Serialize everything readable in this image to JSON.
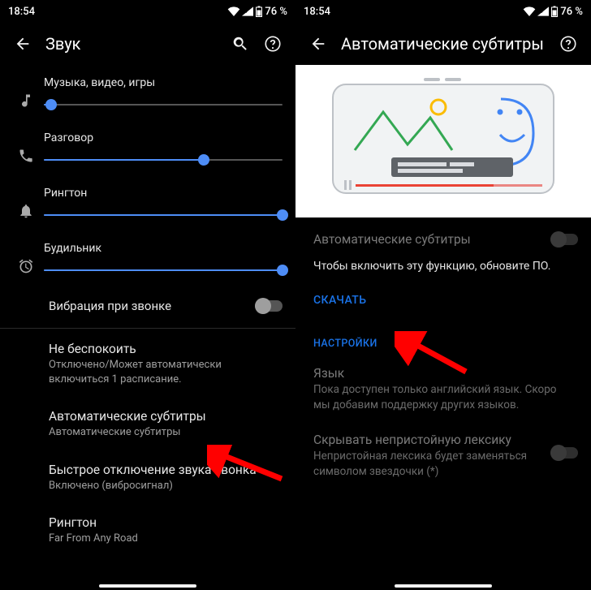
{
  "statusbar": {
    "time": "18:54",
    "battery": "76 %"
  },
  "left": {
    "title": "Звук",
    "volumes": {
      "media": {
        "label": "Музыка, видео, игры",
        "percent": 3
      },
      "call": {
        "label": "Разговор",
        "percent": 67
      },
      "ring": {
        "label": "Рингтон",
        "percent": 100
      },
      "alarm": {
        "label": "Будильник",
        "percent": 100
      }
    },
    "vibrateRing": {
      "label": "Вибрация при звонке",
      "on": false
    },
    "dnd": {
      "title": "Не беспокоить",
      "subtitle": "Отключено/Может автоматически включиться 1 расписание."
    },
    "autoCap": {
      "title": "Автоматические субтитры",
      "subtitle": "Автоматические субтитры"
    },
    "quickMute": {
      "title": "Быстрое отключение звука звонка",
      "subtitle": "Включено (вибросигнал)"
    },
    "ringtone": {
      "title": "Рингтон",
      "subtitle": "Far From Any Road"
    }
  },
  "right": {
    "title": "Автоматические субтитры",
    "toggle": {
      "label": "Автоматические субтитры",
      "on": false,
      "disabled": true
    },
    "note": "Чтобы включить эту функцию, обновите ПО.",
    "download": "Скачать",
    "sectionSettings": "Настройки",
    "language": {
      "title": "Язык",
      "subtitle": "Пока доступен только английский язык. Скоро мы добавим поддержку других языков."
    },
    "profanity": {
      "title": "Скрывать непристойную лексику",
      "subtitle": "Непристойная лексика будет заменяться символом звездочки (*)",
      "on": false
    }
  }
}
